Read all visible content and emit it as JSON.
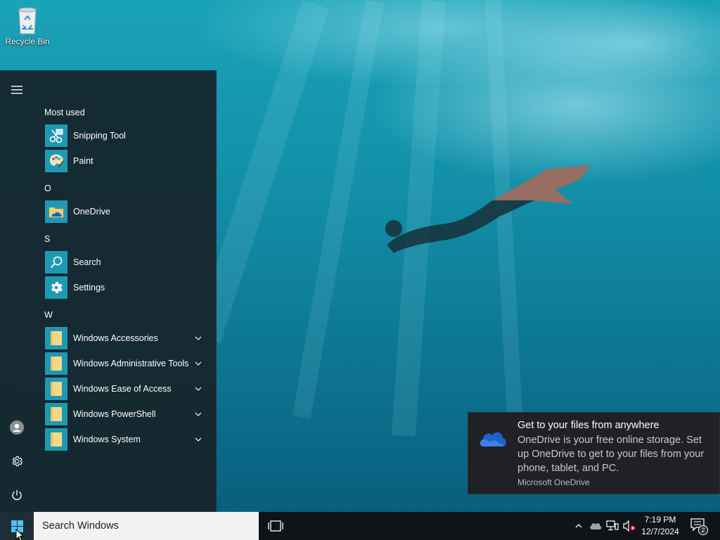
{
  "desktop": {
    "icons": [
      {
        "label": "Recycle Bin",
        "icon": "recycle-bin-icon"
      }
    ]
  },
  "start_menu": {
    "rail": {
      "menu_icon": "hamburger-icon",
      "account_icon": "user-account-icon",
      "settings_icon": "gear-icon",
      "power_icon": "power-icon"
    },
    "groups": {
      "most_used": "Most used",
      "o": "O",
      "s": "S",
      "w": "W"
    },
    "apps": {
      "snipping_tool": "Snipping Tool",
      "paint": "Paint",
      "onedrive": "OneDrive",
      "search": "Search",
      "settings": "Settings",
      "windows_accessories": "Windows Accessories",
      "windows_admin_tools": "Windows Administrative Tools",
      "windows_ease_of_access": "Windows Ease of Access",
      "windows_powershell": "Windows PowerShell",
      "windows_system": "Windows System"
    }
  },
  "toast": {
    "title": "Get to your files from anywhere",
    "body": "OneDrive is your free online storage. Set up OneDrive to get to your files from your phone, tablet, and PC.",
    "source": "Microsoft OneDrive",
    "icon": "onedrive-cloud-icon"
  },
  "taskbar": {
    "start_icon": "windows-logo-icon",
    "search_placeholder": "Search Windows",
    "task_view_icon": "task-view-icon",
    "tray": {
      "chevron_icon": "chevron-up-icon",
      "onedrive_icon": "onedrive-cloud-icon",
      "network_icon": "network-icon",
      "volume_icon": "volume-muted-icon"
    },
    "time": "7:19 PM",
    "date": "12/7/2024",
    "notification_count": "2"
  },
  "colors": {
    "tile_accent": "#1f99b3",
    "start_bg": "#16272e",
    "taskbar_bg": "#101418",
    "toast_bg": "#1f2124"
  }
}
